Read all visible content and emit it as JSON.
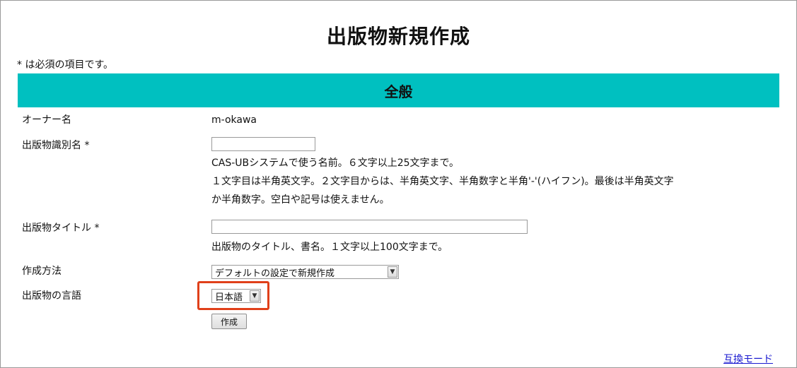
{
  "page": {
    "title": "出版物新規作成",
    "required_note": "* は必須の項目です。"
  },
  "section": {
    "title": "全般"
  },
  "form": {
    "owner_label": "オーナー名",
    "owner_value": "m-okawa",
    "publication_id_label": "出版物識別名 *",
    "publication_id_value": "",
    "publication_id_help": [
      "CAS-UBシステムで使う名前。６文字以上25文字まで。",
      "１文字目は半角英文字。２文字目からは、半角英文字、半角数字と半角'-'(ハイフン)。最後は半角英文字",
      "か半角数字。空白や記号は使えません。"
    ],
    "publication_title_label": "出版物タイトル *",
    "publication_title_value": "",
    "publication_title_help": "出版物のタイトル、書名。１文字以上100文字まで。",
    "creation_method_label": "作成方法",
    "creation_method_selected": "デフォルトの設定で新規作成",
    "language_label": "出版物の言語",
    "language_selected": "日本語",
    "submit_label": "作成"
  },
  "footer": {
    "compat_mode_link": "互換モード"
  },
  "colors": {
    "section_bar": "#00c0c0",
    "highlight": "#e0401a",
    "link": "#1a1ad0"
  }
}
